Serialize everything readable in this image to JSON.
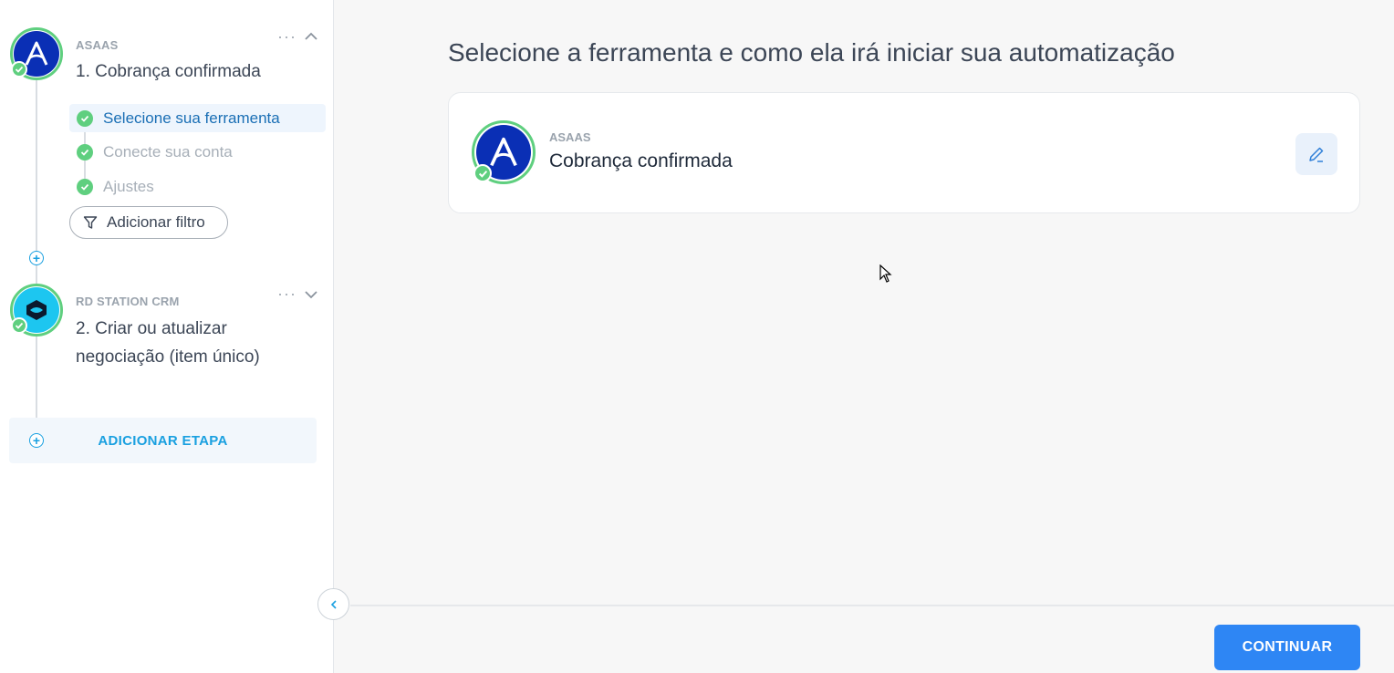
{
  "sidebar": {
    "steps": [
      {
        "app": "ASAAS",
        "title": "1. Cobrança confirmada",
        "more": "···",
        "substeps": [
          {
            "label": "Selecione sua ferramenta"
          },
          {
            "label": "Conecte sua conta"
          },
          {
            "label": "Ajustes"
          }
        ],
        "filter_label": "Adicionar filtro"
      },
      {
        "app": "RD STATION CRM",
        "title_line1": "2. Criar ou atualizar",
        "title_line2": "negociação (item único)",
        "more": "···"
      }
    ],
    "add_step_label": "ADICIONAR ETAPA"
  },
  "main": {
    "title": "Selecione a ferramenta e como ela irá iniciar sua automatização",
    "card": {
      "app": "ASAAS",
      "trigger": "Cobrança confirmada"
    },
    "continue_label": "CONTINUAR"
  },
  "colors": {
    "accent": "#2e86f4",
    "success": "#5fcf7f",
    "asaas": "#0a2fb5",
    "rd": "#1dc6f0"
  }
}
